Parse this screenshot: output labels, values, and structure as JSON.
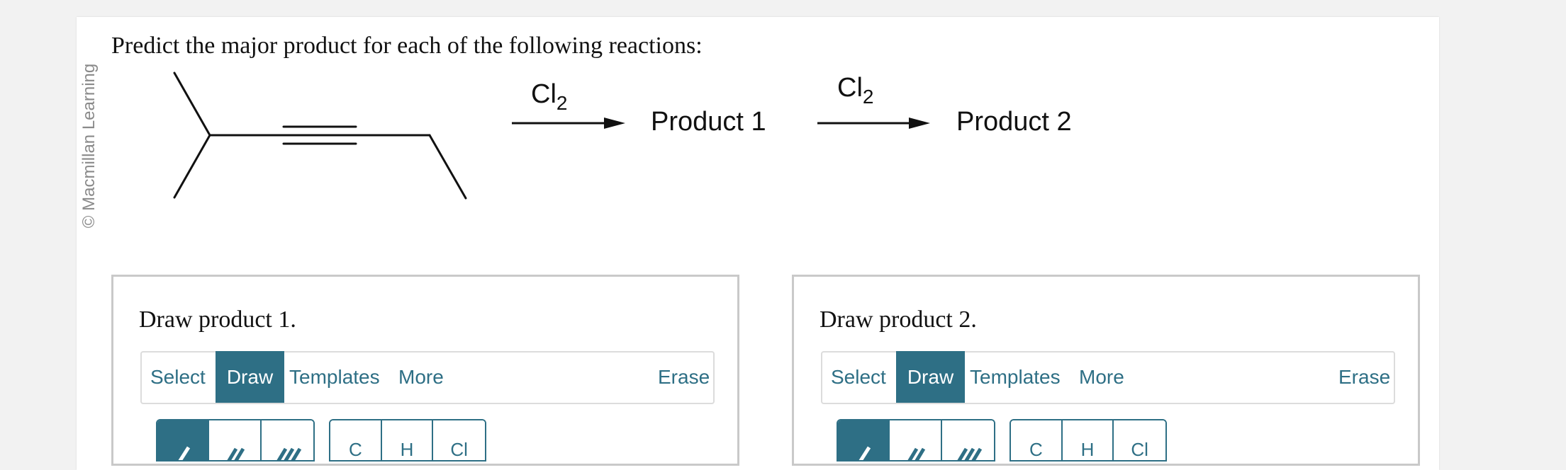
{
  "copyright": "© Macmillan Learning",
  "question": "Predict the major product for each of the following reactions:",
  "reaction": {
    "reagent1": "Cl",
    "reagent1_sub": "2",
    "product1": "Product 1",
    "reagent2": "Cl",
    "reagent2_sub": "2",
    "product2": "Product 2"
  },
  "panels": [
    {
      "title": "Draw product 1.",
      "tabs": {
        "select": "Select",
        "draw": "Draw",
        "templates": "Templates",
        "more": "More",
        "erase": "Erase"
      },
      "active_tab": "Draw",
      "bond_tools": [
        "single-bond-icon",
        "double-bond-icon",
        "triple-bond-icon"
      ],
      "active_bond_tool": "single-bond-icon",
      "elements": [
        "C",
        "H",
        "Cl"
      ]
    },
    {
      "title": "Draw product 2.",
      "tabs": {
        "select": "Select",
        "draw": "Draw",
        "templates": "Templates",
        "more": "More",
        "erase": "Erase"
      },
      "active_tab": "Draw",
      "bond_tools": [
        "single-bond-icon",
        "double-bond-icon",
        "triple-bond-icon"
      ],
      "active_bond_tool": "single-bond-icon",
      "elements": [
        "C",
        "H",
        "Cl"
      ]
    }
  ],
  "colors": {
    "accent": "#2e6f85",
    "panel_border": "#c9c9c9",
    "background": "#f2f2f2"
  }
}
